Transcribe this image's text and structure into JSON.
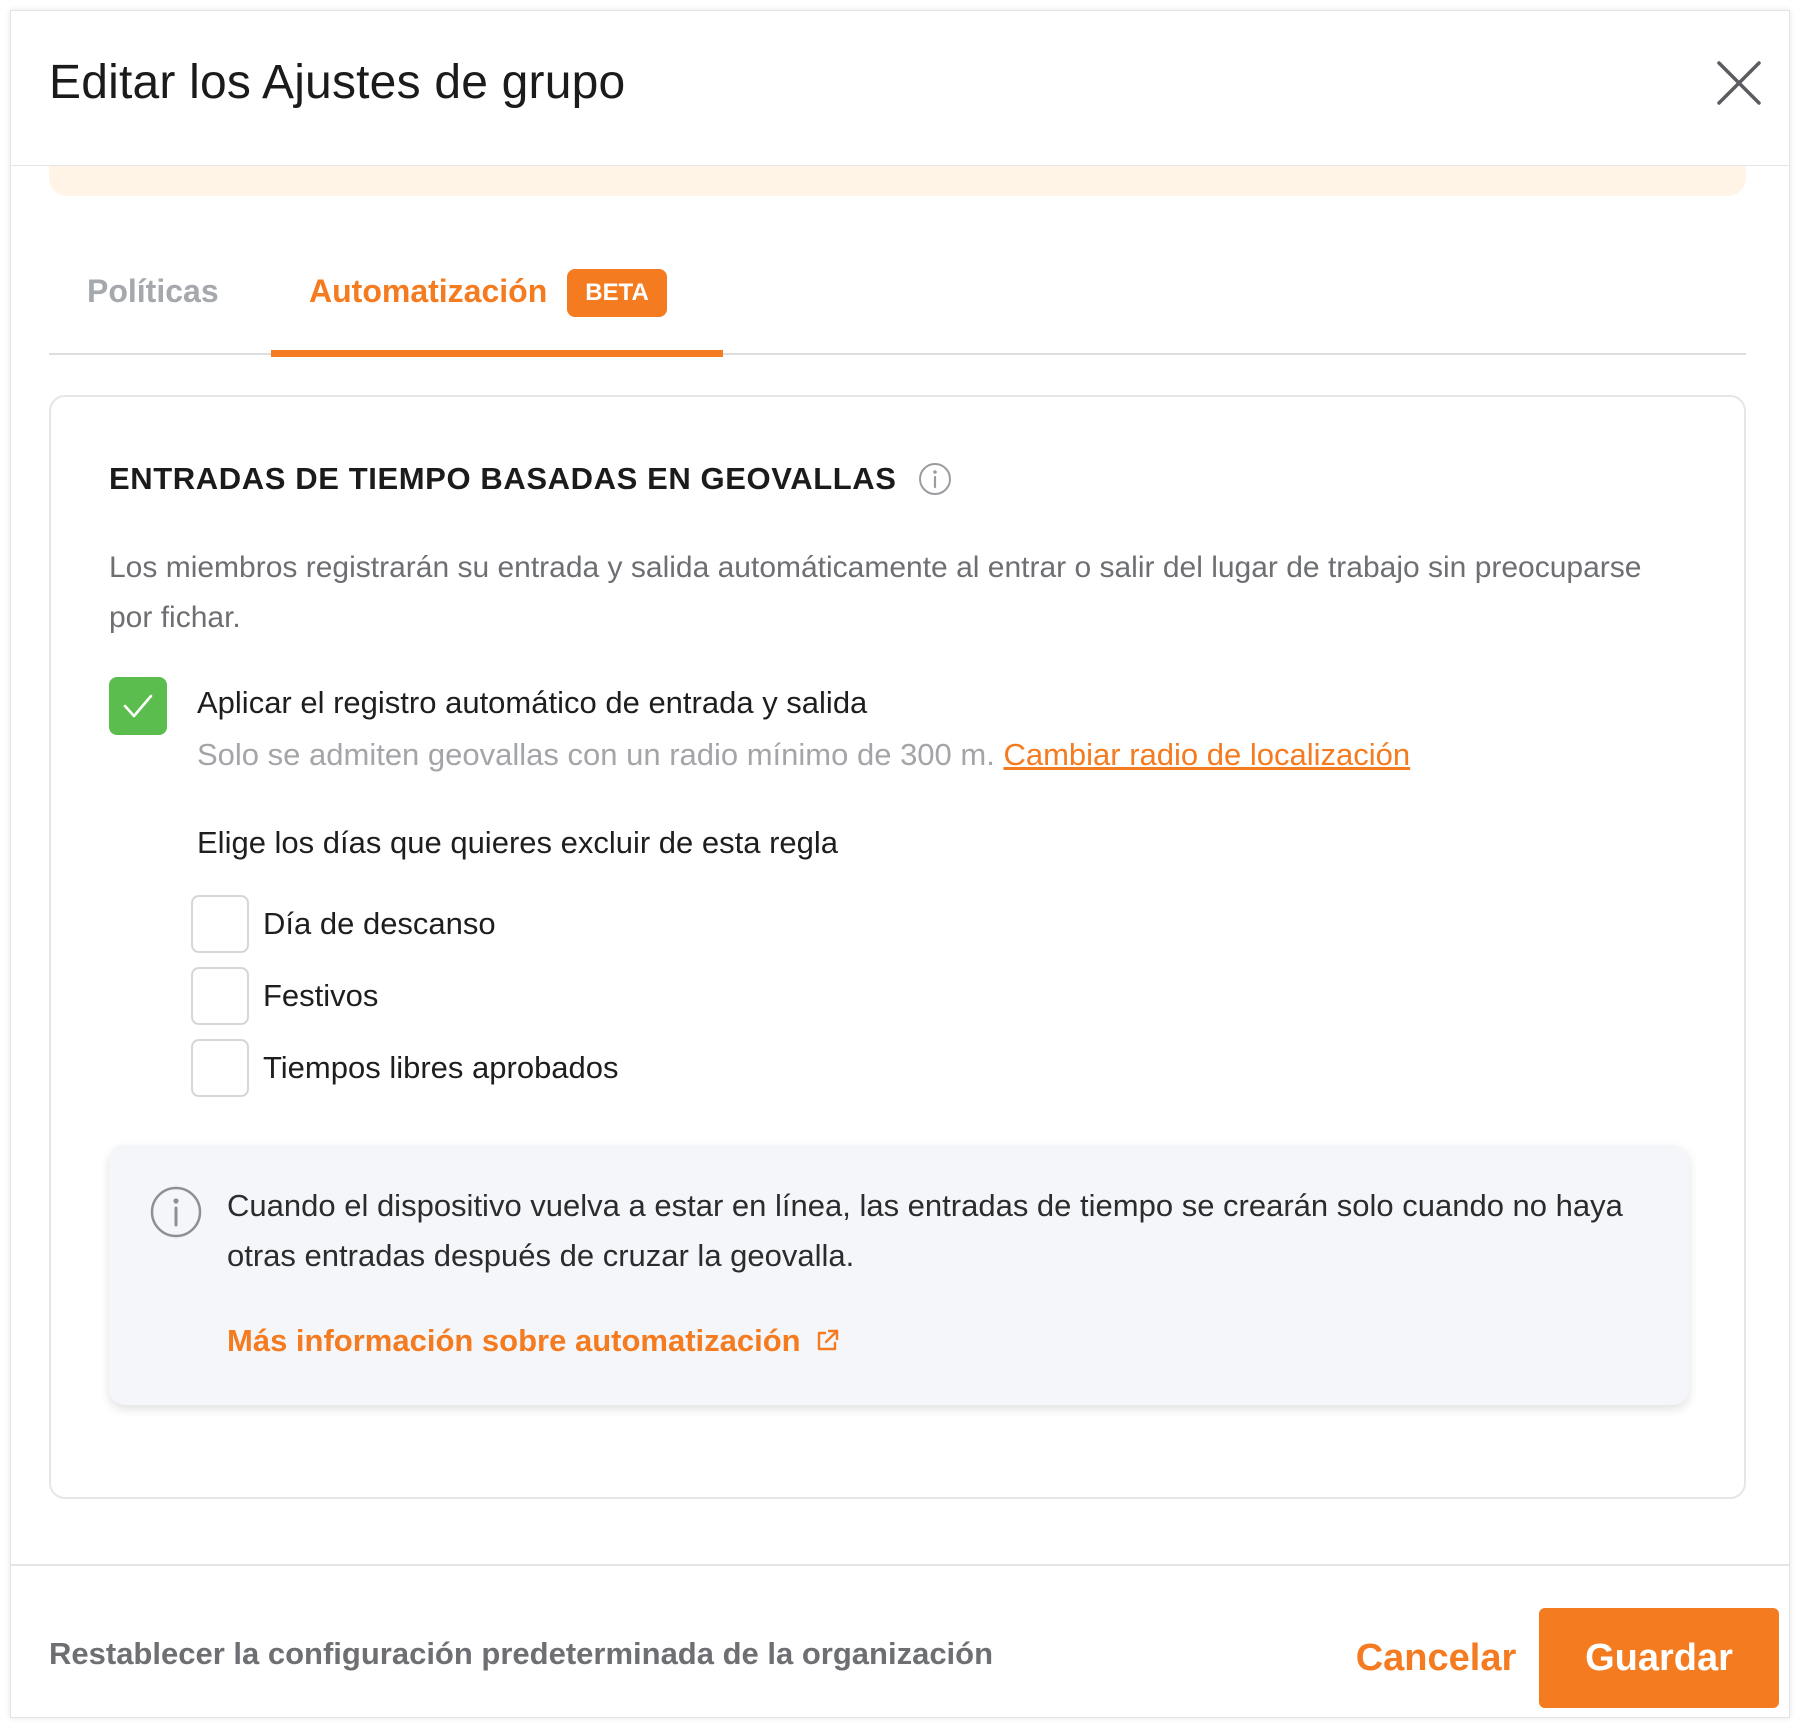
{
  "modal": {
    "title": "Editar los Ajustes de grupo",
    "close_icon": "close-icon"
  },
  "tabs": [
    {
      "label": "Políticas",
      "active": false
    },
    {
      "label": "Automatización",
      "active": true,
      "badge": "BETA"
    }
  ],
  "section": {
    "title": "ENTRADAS DE TIEMPO BASADAS EN GEOVALLAS",
    "title_icon": "info-icon",
    "description": "Los miembros registrarán su entrada y salida automáticamente al entrar o salir del lugar de trabajo sin preocuparse por fichar.",
    "apply_checkbox": {
      "checked": true,
      "label": "Aplicar el registro automático de entrada y salida",
      "sub_text": "Solo se admiten geovallas con un radio mínimo de 300 m.",
      "link": "Cambiar radio de localización"
    },
    "exclude_title": "Elige los días que quieres excluir de esta regla",
    "exclude_options": [
      {
        "label": "Día de descanso",
        "checked": false
      },
      {
        "label": "Festivos",
        "checked": false
      },
      {
        "label": "Tiempos libres aprobados",
        "checked": false
      }
    ],
    "note": {
      "icon": "info-icon",
      "text": "Cuando el dispositivo vuelva a estar en línea, las entradas de tiempo se crearán solo cuando no haya otras entradas después de cruzar la geovalla.",
      "link": "Más información sobre automatización",
      "link_icon": "external-link-icon"
    }
  },
  "footer": {
    "reset_label": "Restablecer la configuración predeterminada de la organización",
    "cancel_label": "Cancelar",
    "save_label": "Guardar"
  },
  "colors": {
    "accent": "#f47b20",
    "success": "#5cbd4f",
    "muted_text": "#6d6f73",
    "alert_bg": "#fff4e6",
    "note_bg": "#f5f6f9"
  }
}
